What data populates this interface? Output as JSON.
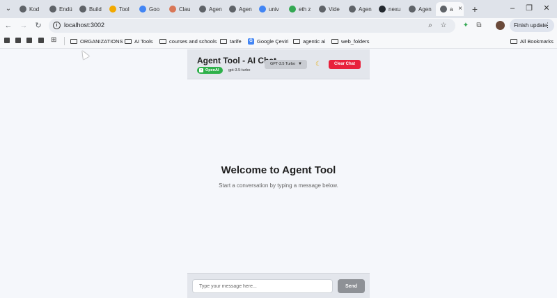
{
  "browser": {
    "tabs": [
      {
        "label": "Kod",
        "icon": "globe-icon",
        "color": "#5f6368"
      },
      {
        "label": "Endü",
        "icon": "globe-icon",
        "color": "#5f6368"
      },
      {
        "label": "Build",
        "icon": "build-icon",
        "color": "#5f6368"
      },
      {
        "label": "Tool",
        "icon": "tool-icon",
        "color": "#f2a900"
      },
      {
        "label": "Goo",
        "icon": "google-translate-icon",
        "color": "#4285f4"
      },
      {
        "label": "Clau",
        "icon": "claude-icon",
        "color": "#d97757"
      },
      {
        "label": "Agen",
        "icon": "globe-icon",
        "color": "#5f6368"
      },
      {
        "label": "Agen",
        "icon": "globe-icon",
        "color": "#5f6368"
      },
      {
        "label": "univ",
        "icon": "google-icon",
        "color": "#4285f4"
      },
      {
        "label": "eth z",
        "icon": "google-icon",
        "color": "#34a853"
      },
      {
        "label": "Vide",
        "icon": "video-icon",
        "color": "#5f6368"
      },
      {
        "label": "Agen",
        "icon": "globe-icon",
        "color": "#5f6368"
      },
      {
        "label": "nexu",
        "icon": "github-icon",
        "color": "#24292f"
      },
      {
        "label": "Agen",
        "icon": "globe-icon",
        "color": "#5f6368"
      },
      {
        "label": "a",
        "icon": "globe-icon",
        "color": "#5f6368"
      }
    ],
    "close_glyph": "×",
    "new_tab_glyph": "+",
    "url": "localhost:3002",
    "finish_update_label": "Finish update"
  },
  "bookmarks": [
    {
      "label": "ORGANIZATIONS",
      "icon": "folder-icon"
    },
    {
      "label": "AI Tools",
      "icon": "folder-icon"
    },
    {
      "label": "courses and schools",
      "icon": "folder-icon"
    },
    {
      "label": "tarife",
      "icon": "folder-icon"
    },
    {
      "label": "Google Çeviri",
      "icon": "google-translate-icon"
    },
    {
      "label": "agentic ai",
      "icon": "folder-icon"
    },
    {
      "label": "web_folders",
      "icon": "folder-icon"
    }
  ],
  "all_bookmarks_label": "All Bookmarks",
  "app": {
    "title": "Agent Tool - AI Chat",
    "provider": "OpenAI",
    "model_name": "gpt-3.5-turbo",
    "model_select_label": "GPT-3.5 Turbo",
    "clear_label": "Clear Chat",
    "theme_icon": "moon-icon",
    "accent_color": "#e8213b",
    "provider_color": "#2eb14a"
  },
  "welcome": {
    "title": "Welcome to Agent Tool",
    "subtitle": "Start a conversation by typing a message below."
  },
  "composer": {
    "placeholder": "Type your message here...",
    "value": "",
    "send_label": "Send"
  }
}
